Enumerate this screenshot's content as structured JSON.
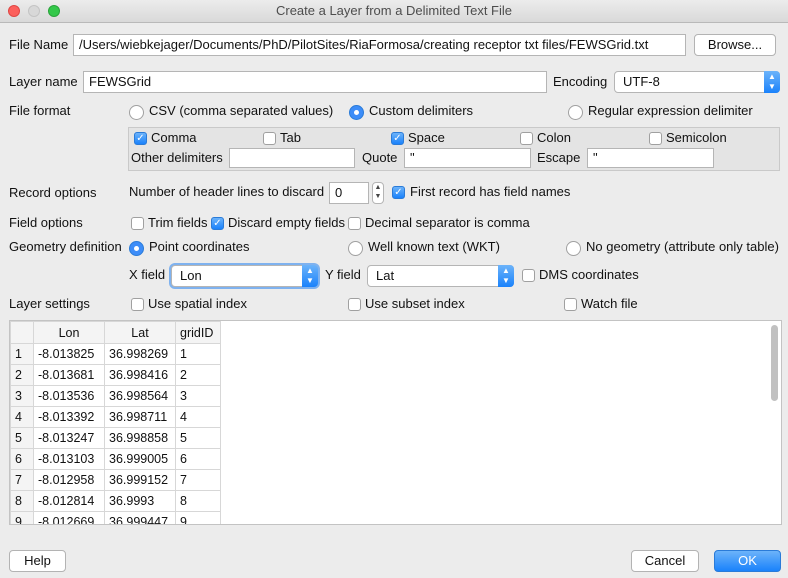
{
  "window": {
    "title": "Create a Layer from a Delimited Text File"
  },
  "file": {
    "label": "File Name",
    "value": "/Users/wiebkejager/Documents/PhD/PilotSites/RiaFormosa/creating receptor txt files/FEWSGrid.txt",
    "browse": "Browse..."
  },
  "layer": {
    "label": "Layer name",
    "value": "FEWSGrid",
    "encoding_label": "Encoding",
    "encoding": "UTF-8"
  },
  "format": {
    "label": "File format",
    "csv": "CSV (comma separated values)",
    "custom": "Custom delimiters",
    "regex": "Regular expression delimiter",
    "comma": "Comma",
    "tab": "Tab",
    "space": "Space",
    "colon": "Colon",
    "semicolon": "Semicolon",
    "other": "Other delimiters",
    "other_value": "",
    "quote": "Quote",
    "quote_value": "\"",
    "escape": "Escape",
    "escape_value": "\""
  },
  "records": {
    "label": "Record options",
    "header_lines_label": "Number of header lines to discard",
    "header_lines": "0",
    "first_record": "First record has field names"
  },
  "fields": {
    "label": "Field options",
    "trim": "Trim fields",
    "discard": "Discard empty fields",
    "decimal": "Decimal separator is comma"
  },
  "geometry": {
    "label": "Geometry definition",
    "point": "Point coordinates",
    "wkt": "Well known text (WKT)",
    "none": "No geometry (attribute only table)",
    "x_label": "X field",
    "x_value": "Lon",
    "y_label": "Y field",
    "y_value": "Lat",
    "dms": "DMS coordinates"
  },
  "settings": {
    "label": "Layer settings",
    "spatial": "Use spatial index",
    "subset": "Use subset index",
    "watch": "Watch file"
  },
  "table": {
    "headers": [
      "Lon",
      "Lat",
      "gridID"
    ],
    "rows": [
      [
        "1",
        "-8.013825",
        "36.998269",
        "1"
      ],
      [
        "2",
        "-8.013681",
        "36.998416",
        "2"
      ],
      [
        "3",
        "-8.013536",
        "36.998564",
        "3"
      ],
      [
        "4",
        "-8.013392",
        "36.998711",
        "4"
      ],
      [
        "5",
        "-8.013247",
        "36.998858",
        "5"
      ],
      [
        "6",
        "-8.013103",
        "36.999005",
        "6"
      ],
      [
        "7",
        "-8.012958",
        "36.999152",
        "7"
      ],
      [
        "8",
        "-8.012814",
        "36.9993",
        "8"
      ],
      [
        "9",
        "-8.012669",
        "36.999447",
        "9"
      ]
    ]
  },
  "buttons": {
    "help": "Help",
    "cancel": "Cancel",
    "ok": "OK"
  }
}
